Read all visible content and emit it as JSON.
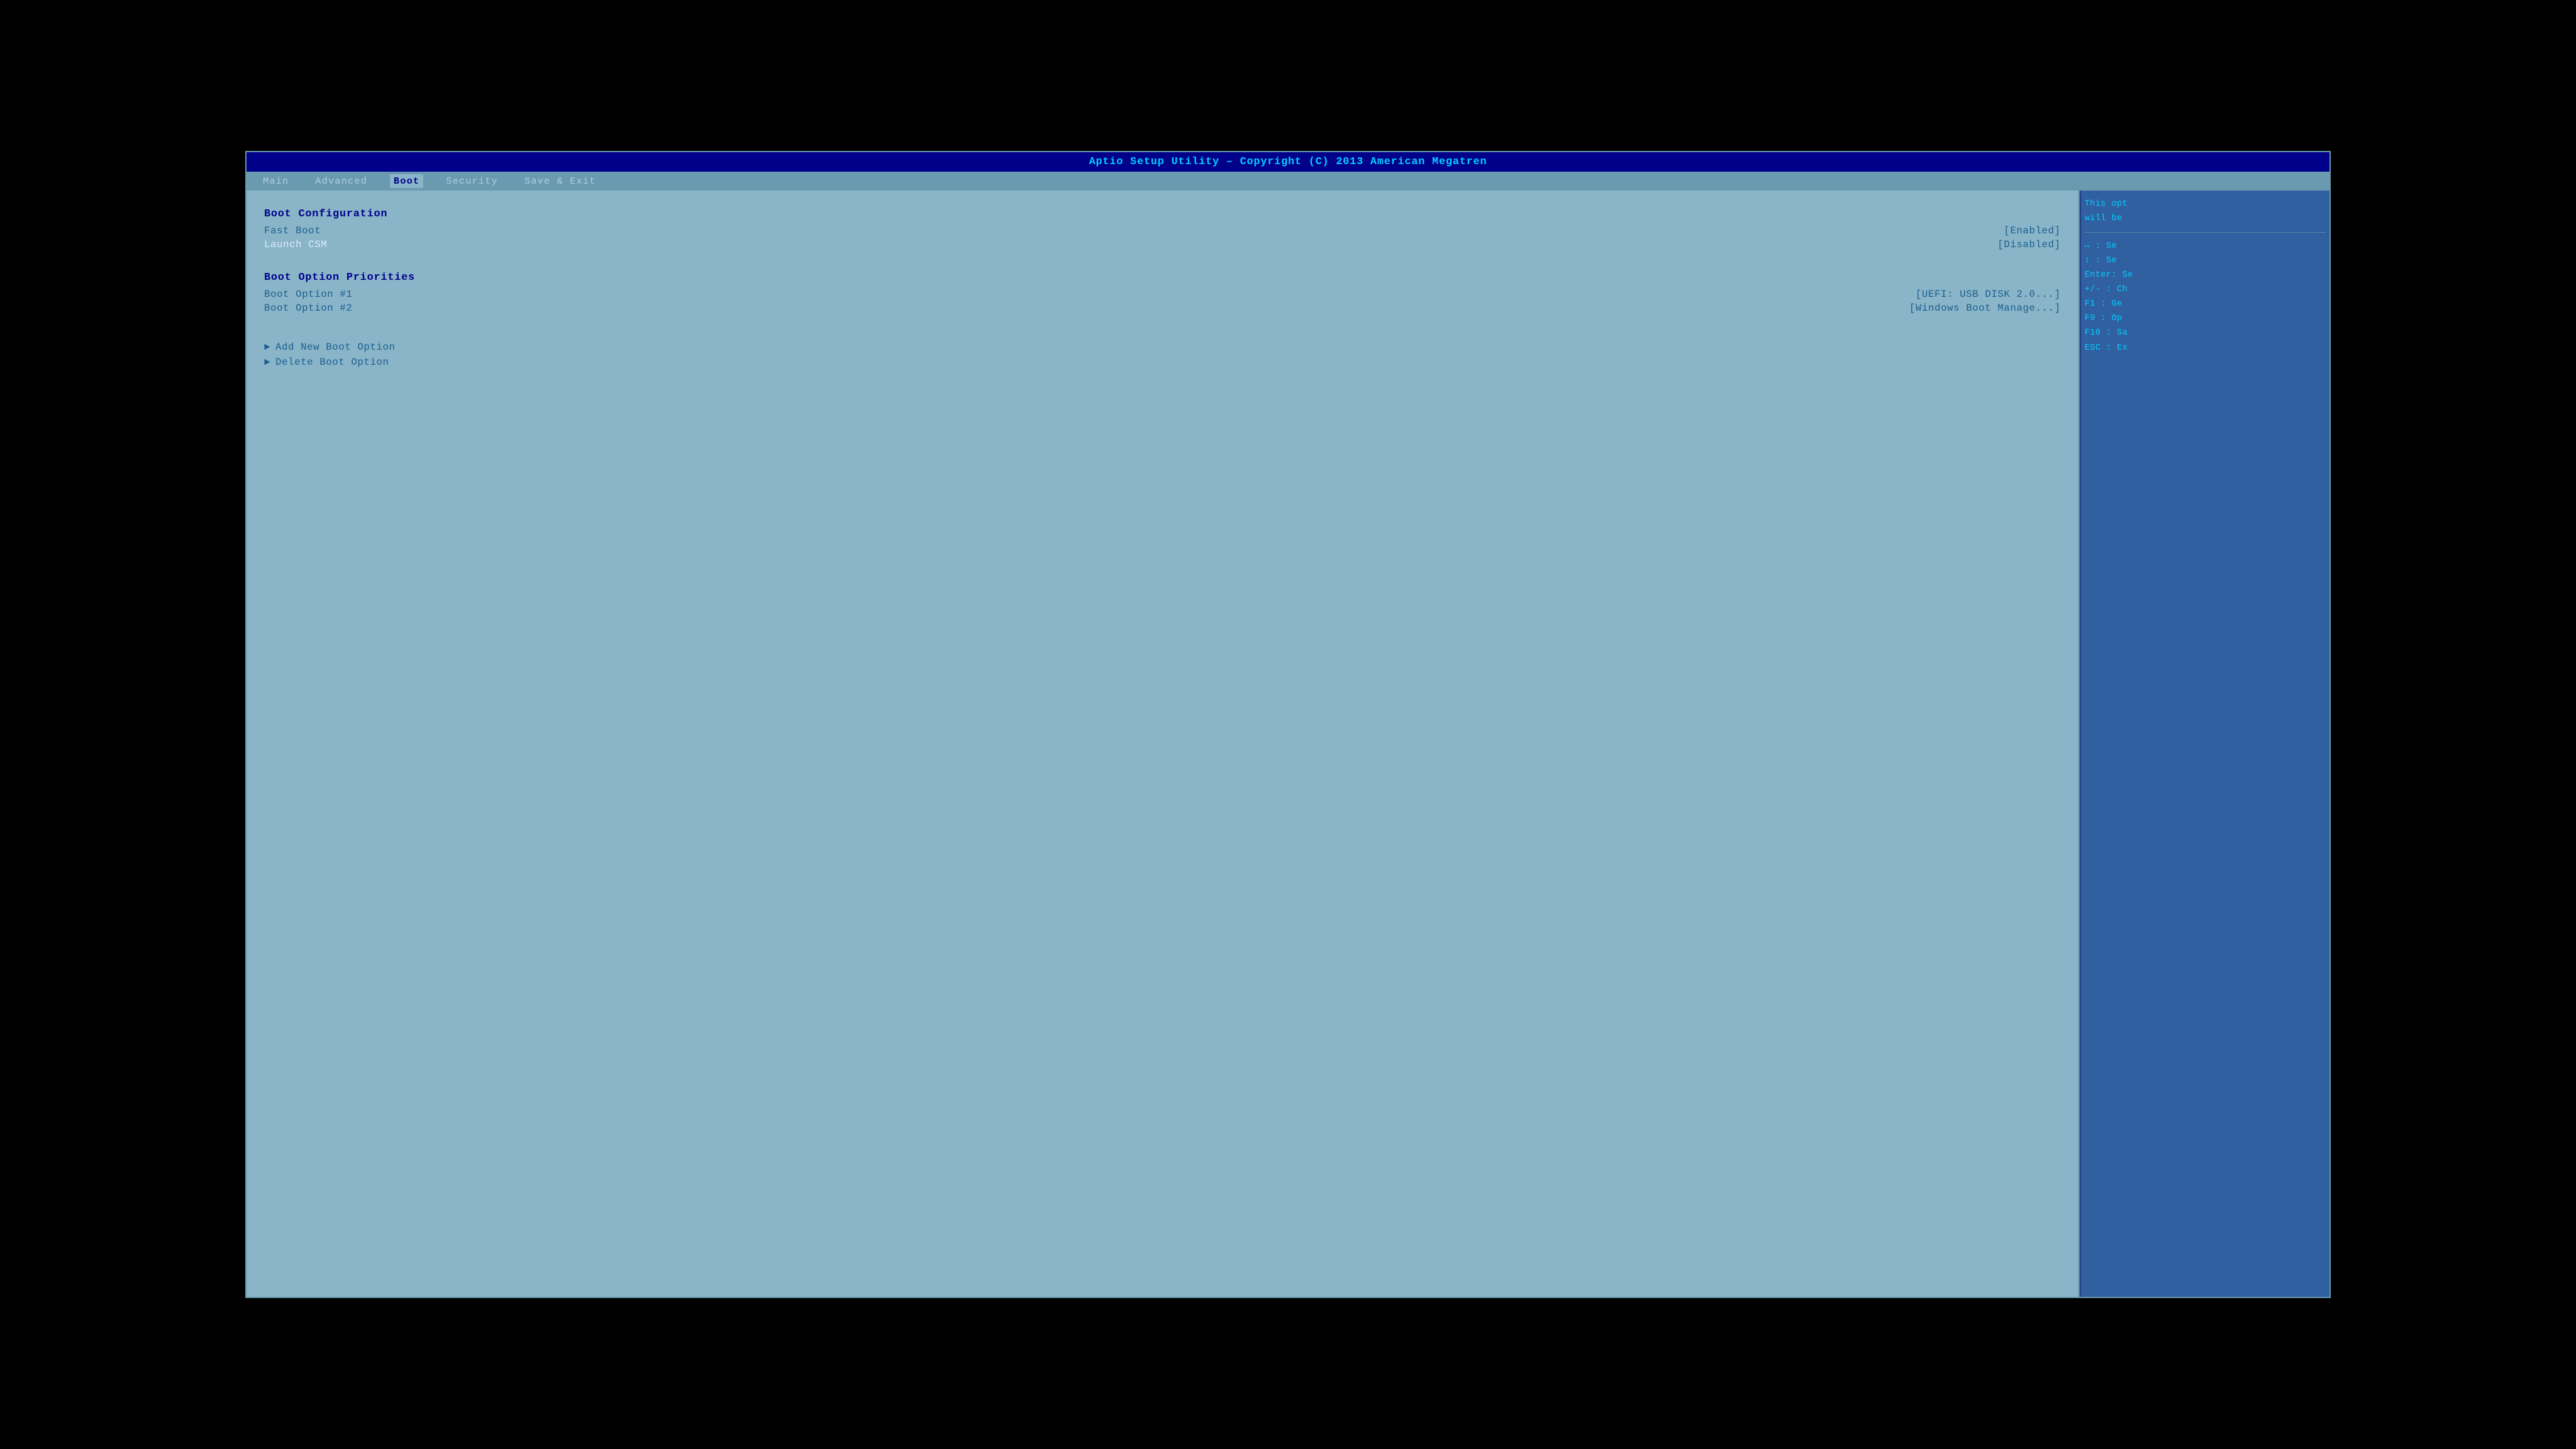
{
  "title_bar": {
    "text": "Aptio Setup Utility – Copyright (C) 2013 American Megatren"
  },
  "nav": {
    "tabs": [
      {
        "label": "Main",
        "active": false
      },
      {
        "label": "Advanced",
        "active": false
      },
      {
        "label": "Boot",
        "active": true
      },
      {
        "label": "Security",
        "active": false
      },
      {
        "label": "Save & Exit",
        "active": false
      }
    ]
  },
  "main": {
    "boot_configuration_header": "Boot Configuration",
    "fast_boot_label": "Fast Boot",
    "fast_boot_value": "[Enabled]",
    "launch_csm_label": "Launch CSM",
    "launch_csm_value": "[Disabled]",
    "boot_option_priorities_header": "Boot Option Priorities",
    "boot_option1_label": "Boot Option #1",
    "boot_option1_value": "[UEFI:  USB DISK 2.0...]",
    "boot_option2_label": "Boot Option #2",
    "boot_option2_value": "[Windows Boot Manage...]",
    "add_new_boot_option": "Add New Boot Option",
    "delete_boot_option": "Delete Boot Option"
  },
  "right_panel": {
    "help_line1": "This opt",
    "help_line2": "will be",
    "divider": true,
    "keys": [
      {
        "key": "←→",
        "desc": ": Se"
      },
      {
        "key": "↑↓",
        "desc": ": Se"
      },
      {
        "key": "Enter",
        "desc": ": Se"
      },
      {
        "key": "+/-",
        "desc": ": Ch"
      },
      {
        "key": "F1",
        "desc": ": Ge"
      },
      {
        "key": "F9",
        "desc": ": Op"
      },
      {
        "key": "F10",
        "desc": ": Sa"
      },
      {
        "key": "ESC",
        "desc": ": Ex"
      }
    ]
  }
}
